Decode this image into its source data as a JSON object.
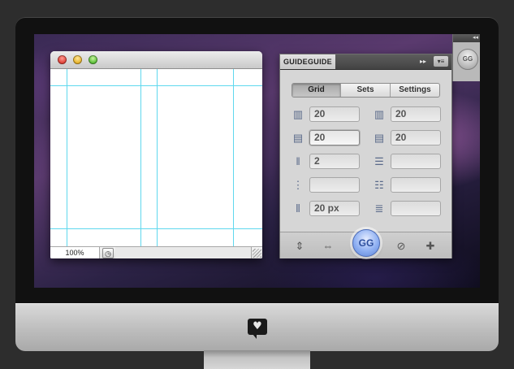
{
  "device": {
    "logo_glyph": "♥"
  },
  "document_window": {
    "zoom_level": "100%",
    "traffic_lights": [
      "close",
      "minimize",
      "zoom"
    ]
  },
  "panel": {
    "tab_title": "GUIDEGUIDE",
    "tab_arrows": "▸▸",
    "tab_menu": "▾≡",
    "segments": [
      "Grid",
      "Sets",
      "Settings"
    ],
    "active_segment": "Grid",
    "rows": [
      {
        "left_icon": "▥",
        "left_value": "20",
        "right_icon": "▥",
        "right_value": "20"
      },
      {
        "left_icon": "▤",
        "left_value": "20",
        "right_icon": "▤",
        "right_value": "20"
      },
      {
        "left_icon": "‖",
        "left_value": "2",
        "right_icon": "☰",
        "right_value": ""
      },
      {
        "left_icon": "⋮",
        "left_value": "",
        "right_icon": "☷",
        "right_value": ""
      },
      {
        "left_icon": "⦀",
        "left_value": "20 px",
        "right_icon": "≣",
        "right_value": ""
      }
    ],
    "footer": {
      "midpoint_horizontal_icon": "⇕",
      "midpoint_vertical_icon": "⇔",
      "gg_label": "GG",
      "clear_icon": "⊘",
      "add_icon": "✚"
    }
  },
  "dock": {
    "collapse_icon": "◂◂",
    "button_label": "GG"
  }
}
